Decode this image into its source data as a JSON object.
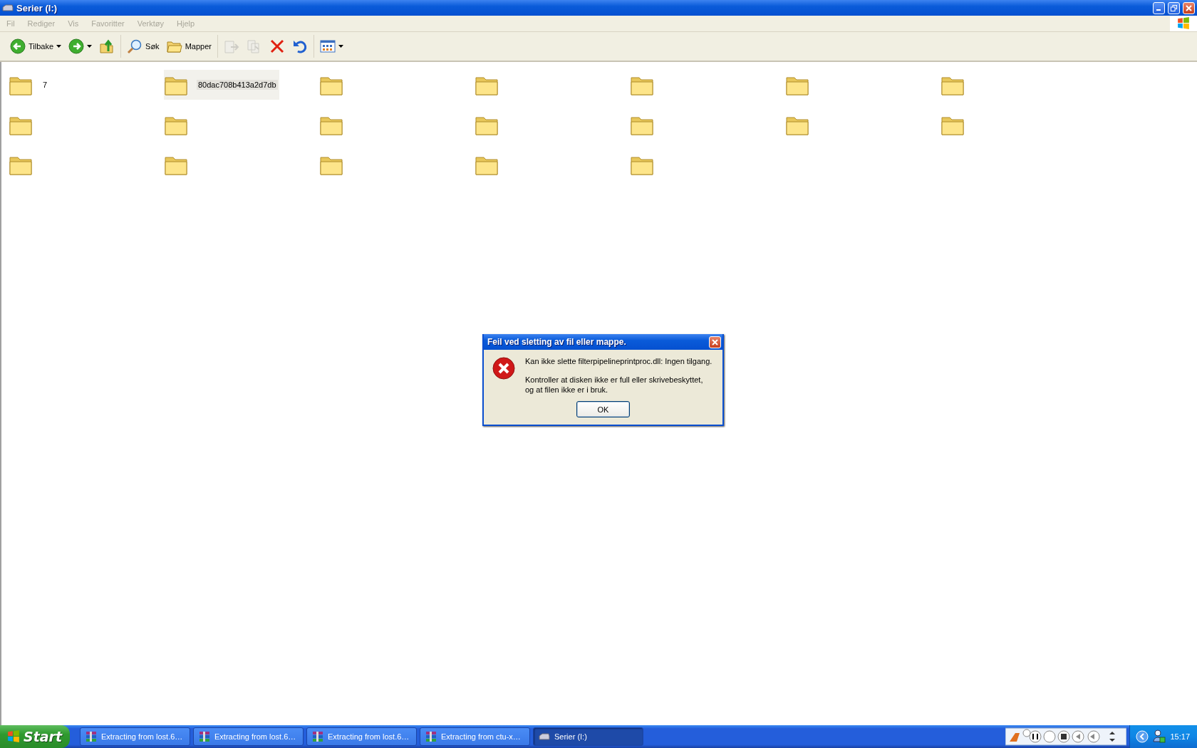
{
  "window": {
    "title": "Serier (I:)"
  },
  "menu": [
    {
      "label": "Fil",
      "disabled": true
    },
    {
      "label": "Rediger",
      "disabled": true
    },
    {
      "label": "Vis",
      "disabled": true
    },
    {
      "label": "Favoritter",
      "disabled": true
    },
    {
      "label": "Verktøy",
      "disabled": true
    },
    {
      "label": "Hjelp",
      "disabled": true
    }
  ],
  "toolbar": [
    [
      {
        "kind": "back",
        "label": "Tilbake",
        "dropdown": true
      },
      {
        "kind": "forward",
        "dropdown": true
      },
      {
        "kind": "up"
      }
    ],
    [
      {
        "kind": "search",
        "label": "Søk"
      },
      {
        "kind": "folders",
        "label": "Mapper"
      }
    ],
    [
      {
        "kind": "move",
        "disabled": true
      },
      {
        "kind": "copy",
        "disabled": true
      },
      {
        "kind": "delete"
      },
      {
        "kind": "undo"
      }
    ],
    [
      {
        "kind": "views",
        "dropdown": true
      }
    ]
  ],
  "folders": [
    {
      "name": "7",
      "selected": false
    },
    {
      "name": "80dac708b413a2d7db",
      "selected": true
    },
    {
      "selected": false
    },
    {
      "selected": false
    },
    {
      "selected": false
    },
    {
      "selected": false
    },
    {
      "selected": false
    },
    {
      "selected": false
    },
    {
      "selected": false
    },
    {
      "selected": false
    },
    {
      "selected": false
    },
    {
      "selected": false
    },
    {
      "selected": false
    },
    {
      "selected": false
    },
    {
      "selected": false
    },
    {
      "selected": false
    },
    {
      "selected": false
    },
    {
      "selected": false
    },
    {
      "selected": false
    }
  ],
  "dialog": {
    "title": "Feil ved sletting av fil eller mappe.",
    "message": "Kan ikke slette filterpipelineprintproc.dll: Ingen tilgang.",
    "details": [
      "Kontroller at disken ikke er full eller skrivebeskyttet,",
      "og at filen ikke er i bruk."
    ],
    "button": "OK"
  },
  "taskbar": {
    "start": "Start",
    "tasks": [
      {
        "kind": "archive",
        "label": "Extracting from lost.6…",
        "selected": false
      },
      {
        "kind": "archive",
        "label": "Extracting from lost.6…",
        "selected": false
      },
      {
        "kind": "archive",
        "label": "Extracting from lost.6…",
        "selected": false
      },
      {
        "kind": "archive",
        "label": "Extracting from ctu-x…",
        "selected": false
      },
      {
        "kind": "drive",
        "label": "Serier (I:)",
        "selected": true
      }
    ],
    "clock": "15:17"
  }
}
